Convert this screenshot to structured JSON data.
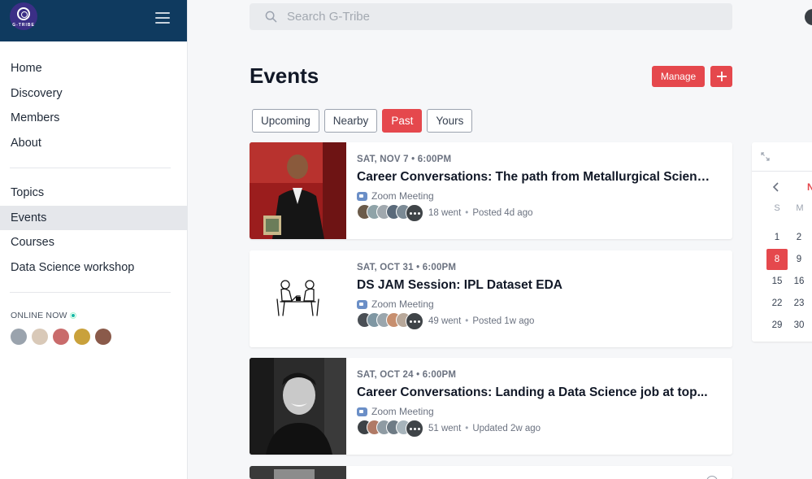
{
  "brand": {
    "logo_text": "G-TRIBE"
  },
  "sidebar": {
    "nav_primary": [
      {
        "label": "Home"
      },
      {
        "label": "Discovery"
      },
      {
        "label": "Members"
      },
      {
        "label": "About"
      }
    ],
    "nav_secondary": [
      {
        "label": "Topics"
      },
      {
        "label": "Events",
        "active": true
      },
      {
        "label": "Courses"
      },
      {
        "label": "Data Science workshop"
      }
    ],
    "online_title": "ONLINE NOW",
    "online_avatar_colors": [
      "#9aa3ad",
      "#d9c9b8",
      "#c96b6b",
      "#c9a13b",
      "#8a5a4a"
    ]
  },
  "search": {
    "placeholder": "Search G-Tribe"
  },
  "page": {
    "title": "Events",
    "manage_label": "Manage",
    "add_label": "+",
    "tabs": [
      {
        "label": "Upcoming",
        "active": false
      },
      {
        "label": "Nearby",
        "active": false
      },
      {
        "label": "Past",
        "active": true
      },
      {
        "label": "Yours",
        "active": false
      }
    ]
  },
  "events": [
    {
      "date": "SAT, NOV 7 • 6:00PM",
      "title": "Career Conversations: The path from Metallurgical Science...",
      "location": "Zoom Meeting",
      "went": "18 went",
      "posted": "Posted 4d ago",
      "thumb": "photo-speaker-red",
      "avatar_colors": [
        "#6b5b4a",
        "#8fa3a8",
        "#a0a8ae",
        "#5a6a7a",
        "#7b8a95"
      ]
    },
    {
      "date": "SAT, OCT 31 • 6:00PM",
      "title": "DS JAM Session: IPL Dataset EDA",
      "location": "Zoom Meeting",
      "went": "49 went",
      "posted": "Posted 1w ago",
      "thumb": "illustration-two-people-table",
      "avatar_colors": [
        "#4a4f55",
        "#7f97a3",
        "#9aa6ad",
        "#c78f6f",
        "#b8a89a"
      ]
    },
    {
      "date": "SAT, OCT 24 • 6:00PM",
      "title": "Career Conversations: Landing a Data Science job at top...",
      "location": "Zoom Meeting",
      "went": "51 went",
      "posted": "Updated 2w ago",
      "thumb": "photo-portrait-bw",
      "avatar_colors": [
        "#3d4246",
        "#b07a66",
        "#8f9ba3",
        "#6e7b85",
        "#a7b4bb"
      ]
    }
  ],
  "calendar": {
    "month_initial": "N",
    "days_of_week": [
      "S",
      "M"
    ],
    "weeks": [
      [
        "1",
        "2"
      ],
      [
        "8",
        "9"
      ],
      [
        "15",
        "16"
      ],
      [
        "22",
        "23"
      ],
      [
        "29",
        "30"
      ]
    ],
    "selected": "8"
  },
  "colors": {
    "accent": "#e5484d",
    "header": "#0f3a5f",
    "logo": "#3b2f86"
  }
}
